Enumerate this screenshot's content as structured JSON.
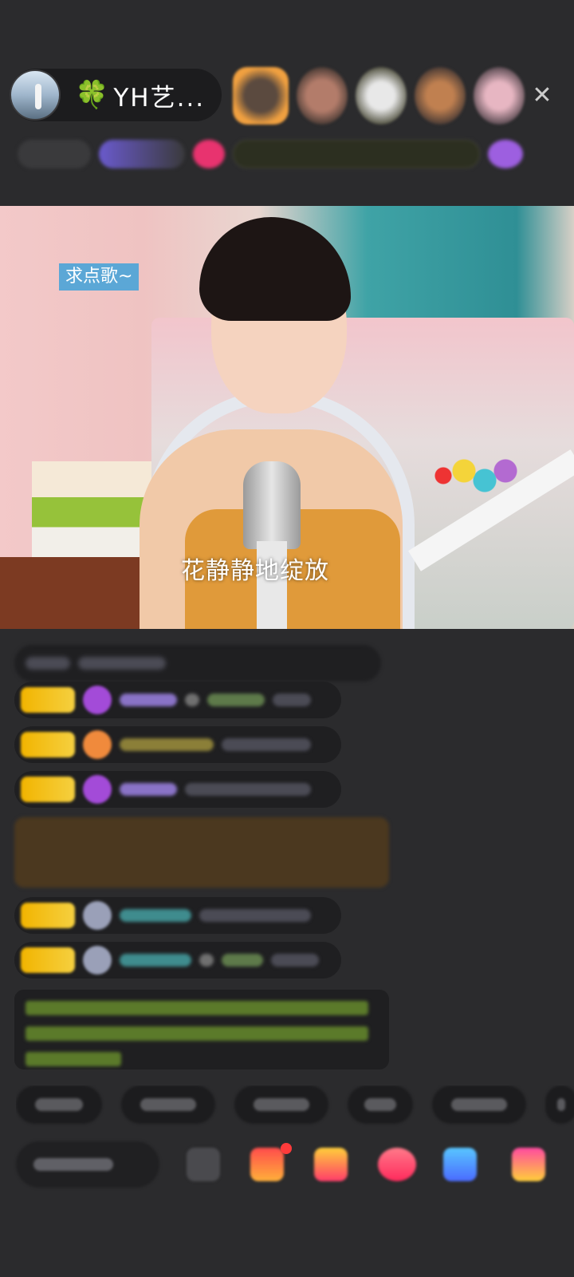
{
  "header": {
    "host_name": "YH艺...",
    "clover_icon": "🍀",
    "close_icon": "✕"
  },
  "video": {
    "song_request_label": "求点歌~",
    "lyric": "花静静地绽放"
  },
  "colors": {
    "background": "#2b2b2d",
    "level_badge": "#f2b400",
    "song_request_bg": "#5ba7d6"
  },
  "icons": {
    "host_avatar": "avatar",
    "close": "close-icon",
    "emoji": "emoji-icon",
    "gift": "gift-icon"
  }
}
